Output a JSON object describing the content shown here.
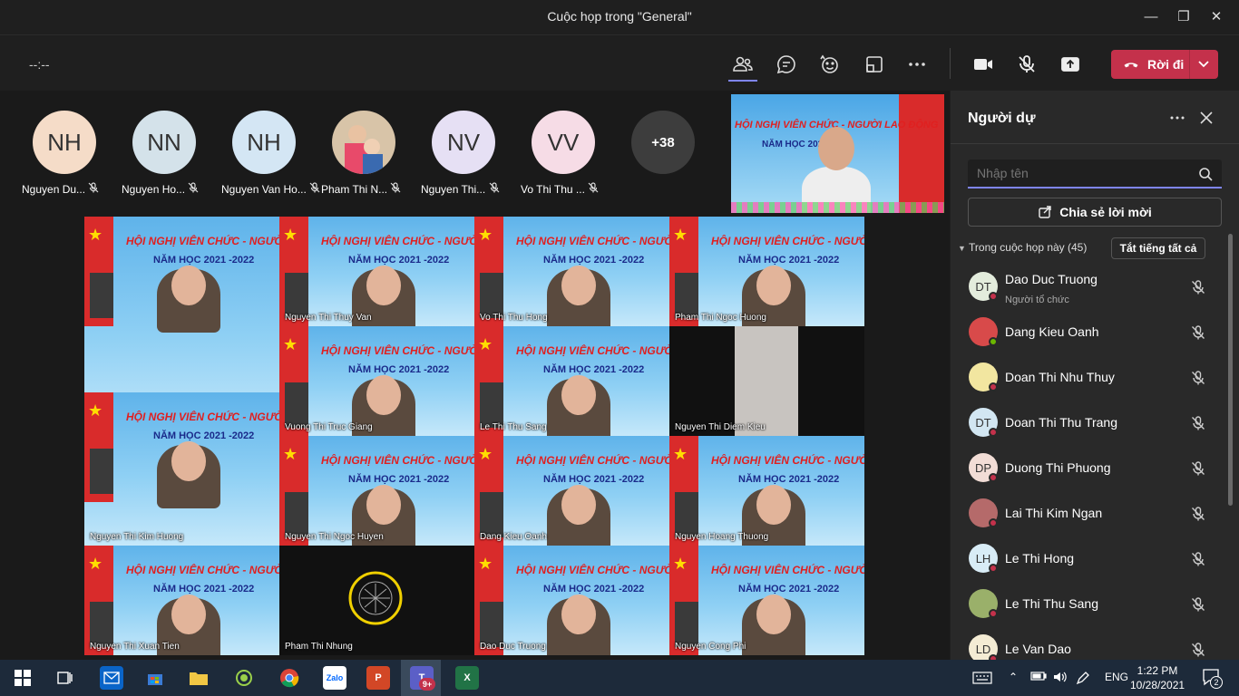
{
  "window": {
    "title": "Cuộc họp trong \"General\""
  },
  "toolbar": {
    "timer": "--:--",
    "leave_label": "Rời đi"
  },
  "avatars": [
    {
      "initials": "NH",
      "name": "Nguyen Du...",
      "color": "#f5dcc8"
    },
    {
      "initials": "NN",
      "name": "Nguyen Ho...",
      "color": "#d4e2ea"
    },
    {
      "initials": "NH",
      "name": "Nguyen Van Ho...",
      "color": "#d4e6f4"
    },
    {
      "initials": "",
      "name": "Pham Thi N...",
      "color": "#c9a27a"
    },
    {
      "initials": "NV",
      "name": "Nguyen Thi...",
      "color": "#e6e0f4"
    },
    {
      "initials": "VV",
      "name": "Vo Thi Thu ...",
      "color": "#f6dce6"
    },
    {
      "initials": "+38",
      "name": "",
      "color": "#3d3d3d"
    }
  ],
  "pip": {
    "banner": "HỘI NGHỊ VIÊN CHỨC - NGƯỜI LAO ĐỘNG",
    "sub": "NĂM HỌC 2021 -2022"
  },
  "tiles": {
    "banner": "HỘI NGHỊ VIÊN CHỨC - NGƯỜI LAO ĐỘNG",
    "sub": "NĂM HỌC 2021 -2022",
    "names": [
      "Lai Thi Kim Ngan",
      "Nguyen Thi Thuy Van",
      "Vo Thi Thu Hong",
      "Pham Thi Ngoc Huong",
      "Vuong Thi Truc Giang",
      "Le Thi Thu Sang",
      "Nguyen Thi Diem Kieu",
      "Nguyen Thi Kim Huong",
      "Nguyen Thi Ngoc Huyen",
      "Dang Kieu Oanh",
      "Nguyen Hoang Thuong",
      "Nguyen Thi Xuan Tien",
      "Pham Thi Nhung",
      "Dao Duc Truong",
      "Nguyen Cong Phi"
    ]
  },
  "panel": {
    "title": "Người dự",
    "search_placeholder": "Nhập tên",
    "share_label": "Chia sẻ lời mời",
    "section_label": "Trong cuộc họp này (45)",
    "mute_all_label": "Tắt tiếng tất cả",
    "participants": [
      {
        "initials": "DT",
        "name": "Dao Duc Truong",
        "role": "Người tổ chức",
        "avatar_color": "#e3ecdc",
        "status_color": "#c4314b"
      },
      {
        "initials": "",
        "name": "Dang Kieu Oanh",
        "role": "",
        "avatar_color": "#d84a4a",
        "status_color": "#6bb700"
      },
      {
        "initials": "",
        "name": "Doan Thi Nhu Thuy",
        "role": "",
        "avatar_color": "#f2e6a0",
        "status_color": "#c4314b"
      },
      {
        "initials": "DT",
        "name": "Doan Thi Thu Trang",
        "role": "",
        "avatar_color": "#d2e6f2",
        "status_color": "#c4314b"
      },
      {
        "initials": "DP",
        "name": "Duong Thi Phuong",
        "role": "",
        "avatar_color": "#f2ddd6",
        "status_color": "#c4314b"
      },
      {
        "initials": "",
        "name": "Lai Thi Kim Ngan",
        "role": "",
        "avatar_color": "#b56a6a",
        "status_color": "#c4314b"
      },
      {
        "initials": "LH",
        "name": "Le Thi Hong",
        "role": "",
        "avatar_color": "#d8ecf6",
        "status_color": "#c4314b"
      },
      {
        "initials": "",
        "name": "Le Thi Thu Sang",
        "role": "",
        "avatar_color": "#9ab06a",
        "status_color": "#c4314b"
      },
      {
        "initials": "LD",
        "name": "Le Van Dao",
        "role": "",
        "avatar_color": "#f4ecd4",
        "status_color": "#c4314b"
      }
    ]
  },
  "taskbar": {
    "lang": "ENG",
    "time": "1:22 PM",
    "date": "10/28/2021",
    "notification_count": "2",
    "teams_badge": "9+"
  }
}
